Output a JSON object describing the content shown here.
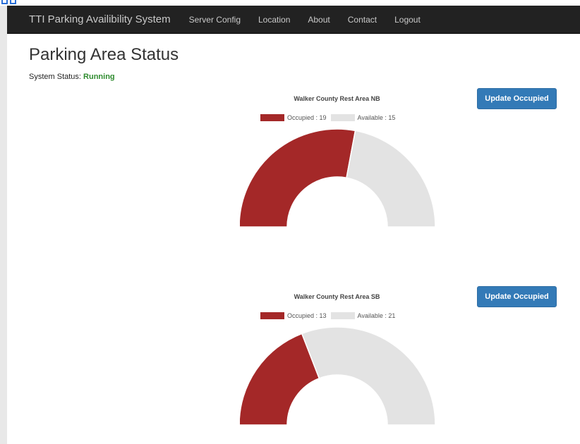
{
  "navbar": {
    "brand": "TTI Parking Availibility System",
    "links": [
      "Server Config",
      "Location",
      "About",
      "Contact",
      "Logout"
    ]
  },
  "page": {
    "title": "Parking Area Status",
    "status_label": "System Status:",
    "status_value": "Running"
  },
  "colors": {
    "occupied": "#a42828",
    "available": "#e3e3e3",
    "status_running": "#2e8b2e",
    "button": "#337ab7"
  },
  "chart_data": [
    {
      "type": "pie",
      "variant": "half-doughnut",
      "title": "Walker County Rest Area NB",
      "categories": [
        "Occupied",
        "Available"
      ],
      "values": [
        19,
        15
      ],
      "legend": [
        "Occupied : 19",
        "Available : 15"
      ],
      "legend_placement": "top",
      "button_label": "Update Occupied"
    },
    {
      "type": "pie",
      "variant": "half-doughnut",
      "title": "Walker County Rest Area SB",
      "categories": [
        "Occupied",
        "Available"
      ],
      "values": [
        13,
        21
      ],
      "legend": [
        "Occupied : 13",
        "Available : 21"
      ],
      "legend_placement": "top",
      "button_label": "Update Occupied"
    }
  ]
}
